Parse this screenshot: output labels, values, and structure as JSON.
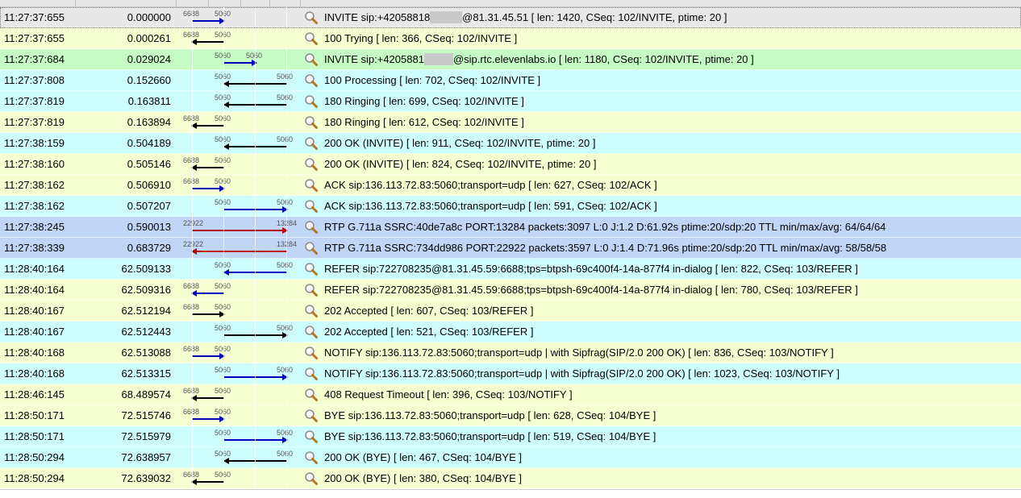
{
  "colors": {
    "yellow_row": "#f6ffd2",
    "cyan_row": "#cdfdfd",
    "green_row": "#c6fbc6",
    "blue_row": "#c0d6f6",
    "selected_row": "#e8e8e8",
    "arrow_blue": "#0000bb",
    "arrow_black": "#000000",
    "arrow_red": "#bb0000"
  },
  "icon": "search-magnifier-icon",
  "rows": [
    {
      "time": "11:27:37:655",
      "rel": "0.000000",
      "bg": "selected_row",
      "arrow": "blue",
      "dir": "right",
      "seg": "A",
      "p1": "6688",
      "p2": "5060",
      "desc": "INVITE sip:+42058818",
      "redact": true,
      "desc2": "@81.31.45.51  [ len: 1420, CSeq: 102/INVITE, ptime: 20 ]"
    },
    {
      "time": "11:27:37:655",
      "rel": "0.000261",
      "bg": "yellow_row",
      "arrow": "black",
      "dir": "left",
      "seg": "A",
      "p1": "6688",
      "p2": "5060",
      "desc": "100 Trying  [ len: 366, CSeq: 102/INVITE ]"
    },
    {
      "time": "11:27:37:684",
      "rel": "0.029024",
      "bg": "green_row",
      "arrow": "blue",
      "dir": "right",
      "seg": "M",
      "p1": "5060",
      "p2": "5060",
      "desc": "INVITE sip:+4205881",
      "redact": true,
      "desc2": "@sip.rtc.elevenlabs.io  [ len: 1180, CSeq: 102/INVITE, ptime: 20 ]"
    },
    {
      "time": "11:27:37:808",
      "rel": "0.152660",
      "bg": "cyan_row",
      "arrow": "black",
      "dir": "left",
      "seg": "B",
      "p1": "5060",
      "p2": "5060",
      "desc": "100 Processing  [ len: 702, CSeq: 102/INVITE ]"
    },
    {
      "time": "11:27:37:819",
      "rel": "0.163811",
      "bg": "cyan_row",
      "arrow": "black",
      "dir": "left",
      "seg": "B",
      "p1": "5060",
      "p2": "5060",
      "desc": "180 Ringing  [ len: 699, CSeq: 102/INVITE ]"
    },
    {
      "time": "11:27:37:819",
      "rel": "0.163894",
      "bg": "yellow_row",
      "arrow": "black",
      "dir": "left",
      "seg": "A",
      "p1": "6688",
      "p2": "5060",
      "desc": "180 Ringing  [ len: 612, CSeq: 102/INVITE ]"
    },
    {
      "time": "11:27:38:159",
      "rel": "0.504189",
      "bg": "cyan_row",
      "arrow": "black",
      "dir": "left",
      "seg": "B",
      "p1": "5060",
      "p2": "5060",
      "desc": "200 OK (INVITE)  [ len: 911, CSeq: 102/INVITE, ptime: 20 ]"
    },
    {
      "time": "11:27:38:160",
      "rel": "0.505146",
      "bg": "yellow_row",
      "arrow": "black",
      "dir": "left",
      "seg": "A",
      "p1": "6688",
      "p2": "5060",
      "desc": "200 OK (INVITE)  [ len: 824, CSeq: 102/INVITE, ptime: 20 ]"
    },
    {
      "time": "11:27:38:162",
      "rel": "0.506910",
      "bg": "yellow_row",
      "arrow": "blue",
      "dir": "right",
      "seg": "A",
      "p1": "6688",
      "p2": "5060",
      "desc": "ACK sip:136.113.72.83:5060;transport=udp  [ len: 627, CSeq: 102/ACK ]"
    },
    {
      "time": "11:27:38:162",
      "rel": "0.507207",
      "bg": "cyan_row",
      "arrow": "blue",
      "dir": "right",
      "seg": "B",
      "p1": "5060",
      "p2": "5060",
      "desc": "ACK sip:136.113.72.83:5060;transport=udp  [ len: 591, CSeq: 102/ACK ]"
    },
    {
      "time": "11:27:38:245",
      "rel": "0.590013",
      "bg": "blue_row",
      "arrow": "red",
      "dir": "right",
      "seg": "R",
      "p1": "22922",
      "p2": "13284",
      "desc": "RTP G.711a SSRC:40de7a8c PORT:13284 packets:3097 L:0 J:1.2 D:61.92s ptime:20/sdp:20 TTL min/max/avg: 64/64/64"
    },
    {
      "time": "11:27:38:339",
      "rel": "0.683729",
      "bg": "blue_row",
      "arrow": "red",
      "dir": "left",
      "seg": "R",
      "p1": "22922",
      "p2": "13284",
      "desc": "RTP G.711a SSRC:734dd986 PORT:22922 packets:3597 L:0 J:1.4 D:71.96s ptime:20/sdp:20 TTL min/max/avg: 58/58/58"
    },
    {
      "time": "11:28:40:164",
      "rel": "62.509133",
      "bg": "cyan_row",
      "arrow": "blue",
      "dir": "left",
      "seg": "B",
      "p1": "5060",
      "p2": "5060",
      "desc": "REFER sip:722708235@81.31.45.59:6688;tps=btpsh-69c400f4-14a-877f4 in-dialog  [ len: 822, CSeq: 103/REFER ]"
    },
    {
      "time": "11:28:40:164",
      "rel": "62.509316",
      "bg": "yellow_row",
      "arrow": "blue",
      "dir": "left",
      "seg": "A",
      "p1": "6688",
      "p2": "5060",
      "desc": "REFER sip:722708235@81.31.45.59:6688;tps=btpsh-69c400f4-14a-877f4 in-dialog  [ len: 780, CSeq: 103/REFER ]"
    },
    {
      "time": "11:28:40:167",
      "rel": "62.512194",
      "bg": "yellow_row",
      "arrow": "black",
      "dir": "right",
      "seg": "A",
      "p1": "6688",
      "p2": "5060",
      "desc": "202 Accepted  [ len: 607, CSeq: 103/REFER ]"
    },
    {
      "time": "11:28:40:167",
      "rel": "62.512443",
      "bg": "cyan_row",
      "arrow": "black",
      "dir": "right",
      "seg": "B",
      "p1": "5060",
      "p2": "5060",
      "desc": "202 Accepted  [ len: 521, CSeq: 103/REFER ]"
    },
    {
      "time": "11:28:40:168",
      "rel": "62.513088",
      "bg": "yellow_row",
      "arrow": "blue",
      "dir": "right",
      "seg": "A",
      "p1": "6688",
      "p2": "5060",
      "desc": "NOTIFY sip:136.113.72.83:5060;transport=udp | with Sipfrag(SIP/2.0 200 OK)  [ len: 836, CSeq: 103/NOTIFY ]"
    },
    {
      "time": "11:28:40:168",
      "rel": "62.513315",
      "bg": "cyan_row",
      "arrow": "blue",
      "dir": "right",
      "seg": "B",
      "p1": "5060",
      "p2": "5060",
      "desc": "NOTIFY sip:136.113.72.83:5060;transport=udp | with Sipfrag(SIP/2.0 200 OK)  [ len: 1023, CSeq: 103/NOTIFY ]"
    },
    {
      "time": "11:28:46:145",
      "rel": "68.489574",
      "bg": "yellow_row",
      "arrow": "black",
      "dir": "left",
      "seg": "A",
      "p1": "6688",
      "p2": "5060",
      "desc": "408 Request Timeout  [ len: 396, CSeq: 103/NOTIFY ]"
    },
    {
      "time": "11:28:50:171",
      "rel": "72.515746",
      "bg": "yellow_row",
      "arrow": "blue",
      "dir": "right",
      "seg": "A",
      "p1": "6688",
      "p2": "5060",
      "desc": "BYE sip:136.113.72.83:5060;transport=udp  [ len: 628, CSeq: 104/BYE ]"
    },
    {
      "time": "11:28:50:171",
      "rel": "72.515979",
      "bg": "cyan_row",
      "arrow": "blue",
      "dir": "right",
      "seg": "B",
      "p1": "5060",
      "p2": "5060",
      "desc": "BYE sip:136.113.72.83:5060;transport=udp  [ len: 519, CSeq: 104/BYE ]"
    },
    {
      "time": "11:28:50:294",
      "rel": "72.638957",
      "bg": "cyan_row",
      "arrow": "black",
      "dir": "left",
      "seg": "B",
      "p1": "5060",
      "p2": "5060",
      "desc": "200 OK (BYE)  [ len: 467, CSeq: 104/BYE ]"
    },
    {
      "time": "11:28:50:294",
      "rel": "72.639032",
      "bg": "yellow_row",
      "arrow": "black",
      "dir": "left",
      "seg": "A",
      "p1": "6688",
      "p2": "5060",
      "desc": "200 OK (BYE)  [ len: 380, CSeq: 104/BYE ]"
    }
  ]
}
